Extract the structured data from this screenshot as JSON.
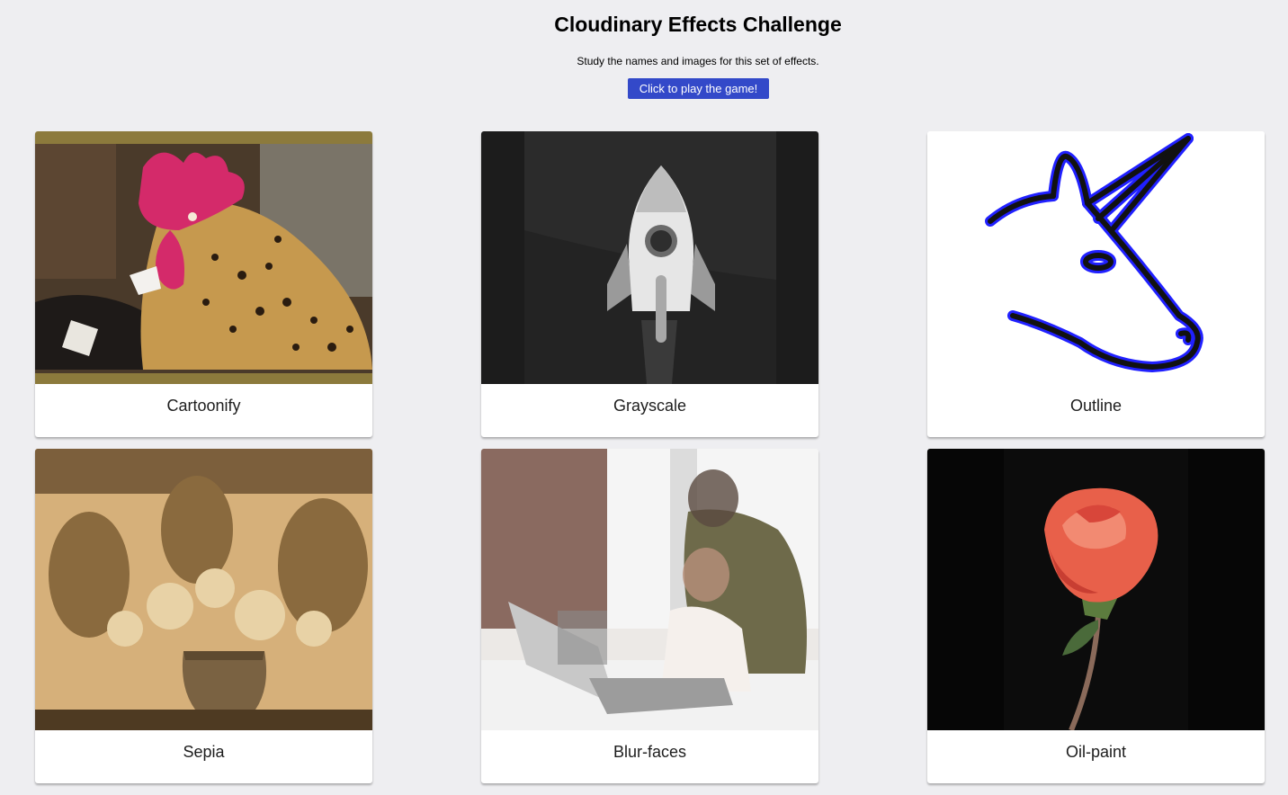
{
  "header": {
    "title": "Cloudinary Effects Challenge",
    "subtitle": "Study the names and images for this set of effects.",
    "play_button_label": "Click to play the game!"
  },
  "colors": {
    "background": "#eeeef1",
    "button": "#3349c9",
    "card": "#ffffff"
  },
  "cards": [
    {
      "label": "Cartoonify",
      "image": "rooster-cartoonified-image"
    },
    {
      "label": "Grayscale",
      "image": "rocket-grayscale-image"
    },
    {
      "label": "Outline",
      "image": "unicorn-outline-image"
    },
    {
      "label": "Sepia",
      "image": "flower-vase-sepia-image"
    },
    {
      "label": "Blur-faces",
      "image": "mother-child-laptop-blurred-faces-image"
    },
    {
      "label": "Oil-paint",
      "image": "rose-oil-paint-image"
    }
  ]
}
